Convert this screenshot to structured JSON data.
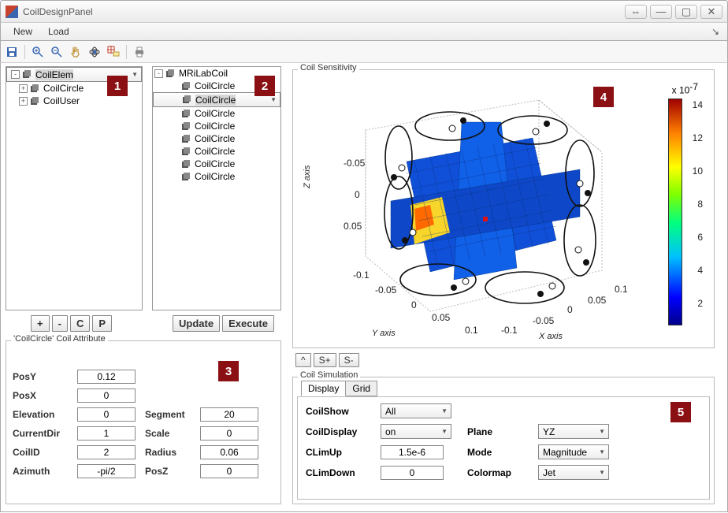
{
  "window": {
    "title": "CoilDesignPanel"
  },
  "menu": {
    "new": "New",
    "load": "Load"
  },
  "tree1": {
    "root": "CoilElem",
    "items": [
      "CoilCircle",
      "CoilUser"
    ]
  },
  "tree2": {
    "root": "MRiLabCoil",
    "items": [
      "CoilCircle",
      "CoilCircle",
      "CoilCircle",
      "CoilCircle",
      "CoilCircle",
      "CoilCircle",
      "CoilCircle",
      "CoilCircle"
    ],
    "selected_index": 1
  },
  "tree_buttons": {
    "add": "+",
    "del": "-",
    "c": "C",
    "p": "P",
    "update": "Update",
    "execute": "Execute"
  },
  "attr": {
    "legend": "'CoilCircle' Coil Attribute",
    "PosY_l": "PosY",
    "PosY": "0.12",
    "PosX_l": "PosX",
    "PosX": "0",
    "Elevation_l": "Elevation",
    "Elevation": "0",
    "CurrentDir_l": "CurrentDir",
    "CurrentDir": "1",
    "CoilID_l": "CoilID",
    "CoilID": "2",
    "Azimuth_l": "Azimuth",
    "Azimuth": "-pi/2",
    "Segment_l": "Segment",
    "Segment": "20",
    "Scale_l": "Scale",
    "Scale": "0",
    "Radius_l": "Radius",
    "Radius": "0.06",
    "PosZ_l": "PosZ",
    "PosZ": "0"
  },
  "plot": {
    "legend": "Coil Sensitivity",
    "zlabel": "Z axis",
    "ylabel": "Y axis",
    "xlabel": "X axis",
    "cbar_exp": "x 10",
    "cbar_exp_sup": "-7",
    "cbar_ticks": [
      "14",
      "12",
      "10",
      "8",
      "6",
      "4",
      "2"
    ],
    "btn_caret": "^",
    "btn_sp": "S+",
    "btn_sm": "S-"
  },
  "sim": {
    "legend": "Coil Simulation",
    "tab_display": "Display",
    "tab_grid": "Grid",
    "CoilShow_l": "CoilShow",
    "CoilShow": "All",
    "CoilDisplay_l": "CoilDisplay",
    "CoilDisplay": "on",
    "CLimUp_l": "CLimUp",
    "CLimUp": "1.5e-6",
    "CLimDown_l": "CLimDown",
    "CLimDown": "0",
    "Plane_l": "Plane",
    "Plane": "YZ",
    "Mode_l": "Mode",
    "Mode": "Magnitude",
    "Colormap_l": "Colormap",
    "Colormap": "Jet"
  },
  "tags": {
    "t1": "1",
    "t2": "2",
    "t3": "3",
    "t4": "4",
    "t5": "5"
  },
  "chart_data": {
    "type": "3d-surface-slices",
    "title": "Coil Sensitivity",
    "x_axis": {
      "label": "X axis",
      "ticks": [
        -0.1,
        -0.05,
        0,
        0.05,
        0.1
      ]
    },
    "y_axis": {
      "label": "Y axis",
      "ticks": [
        -0.1,
        -0.05,
        0,
        0.05,
        0.1
      ]
    },
    "z_axis": {
      "label": "Z axis",
      "ticks": [
        -0.05,
        0,
        0.05
      ]
    },
    "colorbar": {
      "scale_exponent": -7,
      "ticks": [
        2,
        4,
        6,
        8,
        10,
        12,
        14
      ],
      "colormap": "jet"
    },
    "coils": 8,
    "coil_shape": "circle",
    "slices": [
      "XY",
      "XZ",
      "YZ"
    ]
  }
}
